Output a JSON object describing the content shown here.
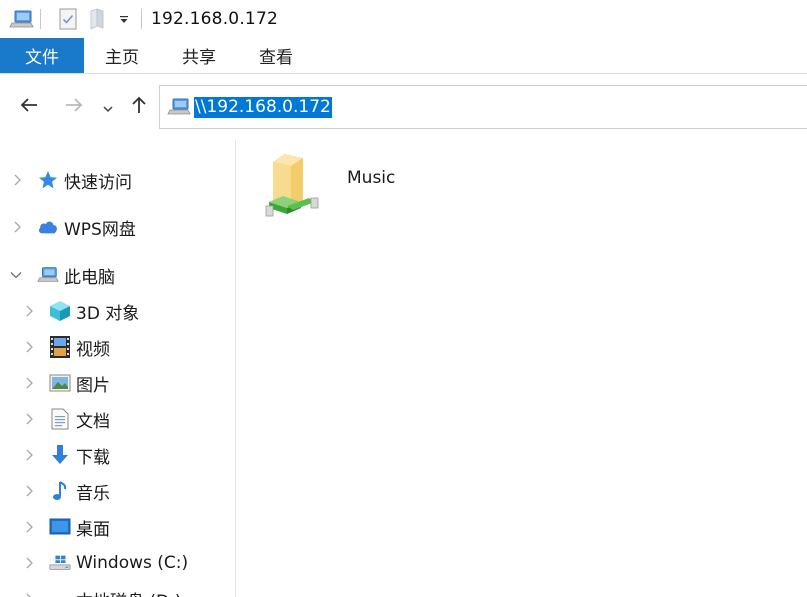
{
  "window": {
    "title": "192.168.0.172"
  },
  "quick_access": {
    "icons": [
      "computer-icon",
      "properties-icon",
      "new-folder-icon",
      "customize-dropdown-icon"
    ]
  },
  "ribbon": {
    "tabs": [
      {
        "label": "文件"
      },
      {
        "label": "主页"
      },
      {
        "label": "共享"
      },
      {
        "label": "查看"
      }
    ]
  },
  "address_bar": {
    "path": "\\\\192.168.0.172"
  },
  "nav_pane": {
    "items": [
      {
        "label": "快速访问",
        "icon": "star-icon"
      },
      {
        "label": "WPS网盘",
        "icon": "cloud-icon"
      },
      {
        "label": "此电脑",
        "icon": "computer-icon"
      },
      {
        "label": "3D 对象",
        "icon": "cube-icon"
      },
      {
        "label": "视频",
        "icon": "film-icon"
      },
      {
        "label": "图片",
        "icon": "picture-icon"
      },
      {
        "label": "文档",
        "icon": "document-icon"
      },
      {
        "label": "下载",
        "icon": "download-icon"
      },
      {
        "label": "音乐",
        "icon": "music-icon"
      },
      {
        "label": "桌面",
        "icon": "desktop-icon"
      },
      {
        "label": "Windows (C:)",
        "icon": "drive-icon"
      },
      {
        "label": "本地磁盘 (D:)",
        "icon": "drive-icon"
      }
    ]
  },
  "content": {
    "items": [
      {
        "name": "Music",
        "icon": "network-share-folder-icon"
      }
    ]
  },
  "colors": {
    "accent": "#0078d7",
    "file_tab": "#1979ca",
    "folder": "#f5d682",
    "share_pipe": "#3aa83a"
  }
}
